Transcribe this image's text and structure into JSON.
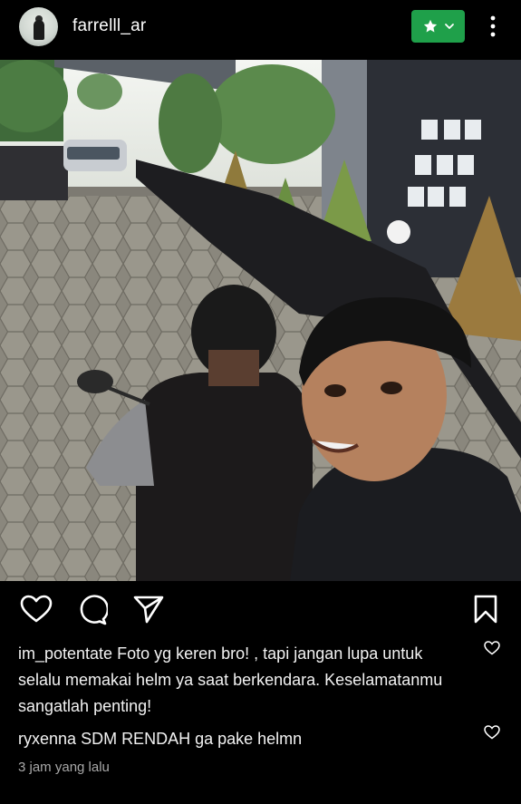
{
  "header": {
    "username": "farrelll_ar",
    "favorite_icon": "star-icon",
    "favorite_color": "#1fa04a",
    "more_icon": "more-vertical-icon"
  },
  "post": {
    "image_description_icon": "photo"
  },
  "actions": {
    "like_icon": "heart-icon",
    "comment_icon": "comment-icon",
    "share_icon": "send-icon",
    "save_icon": "bookmark-icon"
  },
  "comments": [
    {
      "user": "im_potentate",
      "text": "Foto yg keren bro! , tapi jangan lupa untuk selalu memakai helm ya saat berkendara. Keselamatanmu sangatlah penting!"
    },
    {
      "user": "ryxenna",
      "text": "SDM RENDAH ga pake helmn"
    }
  ],
  "timestamp": "3 jam yang lalu"
}
